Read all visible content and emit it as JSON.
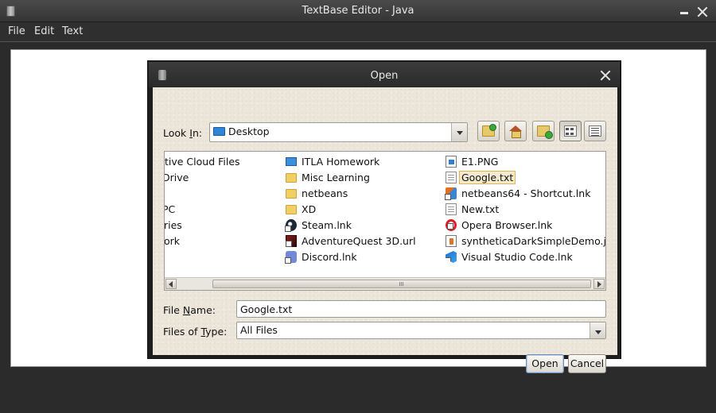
{
  "window": {
    "title": "TextBase Editor - Java"
  },
  "menu": {
    "items": [
      "File",
      "Edit",
      "Text"
    ]
  },
  "dialog": {
    "title": "Open",
    "look_in": {
      "label_pre": "Look ",
      "label_key": "I",
      "label_post": "n:",
      "value": "Desktop"
    },
    "toolbar": {
      "up": "folder-up-icon",
      "home": "home-icon",
      "new_folder": "new-folder-icon",
      "list_view": "list-view-icon",
      "details_view": "details-view-icon"
    },
    "files": {
      "col1": [
        "tive Cloud Files",
        "Drive",
        "",
        "PC",
        "ries",
        "ork",
        ""
      ],
      "col2": [
        "ITLA Homework",
        "Misc Learning",
        "netbeans",
        "XD",
        "Steam.lnk",
        "AdventureQuest 3D.url",
        "Discord.lnk"
      ],
      "col3": [
        "E1.PNG",
        "Google.txt",
        "netbeans64 - Shortcut.lnk",
        "New.txt",
        "Opera Browser.lnk",
        "syntheticaDarkSimpleDemo.jar",
        "Visual Studio Code.lnk"
      ],
      "selected": "Google.txt"
    },
    "file_name": {
      "label_pre": "File ",
      "label_key": "N",
      "label_post": "ame:",
      "value": "Google.txt"
    },
    "file_type": {
      "label_pre": "Files of ",
      "label_key": "T",
      "label_post": "ype:",
      "value": "All Files"
    },
    "buttons": {
      "open": "Open",
      "cancel": "Cancel"
    }
  },
  "colors": {
    "selection_outline": "#e3b44a",
    "selection_fill": "#f3ead0",
    "dialog_bg": "#ece6da"
  }
}
